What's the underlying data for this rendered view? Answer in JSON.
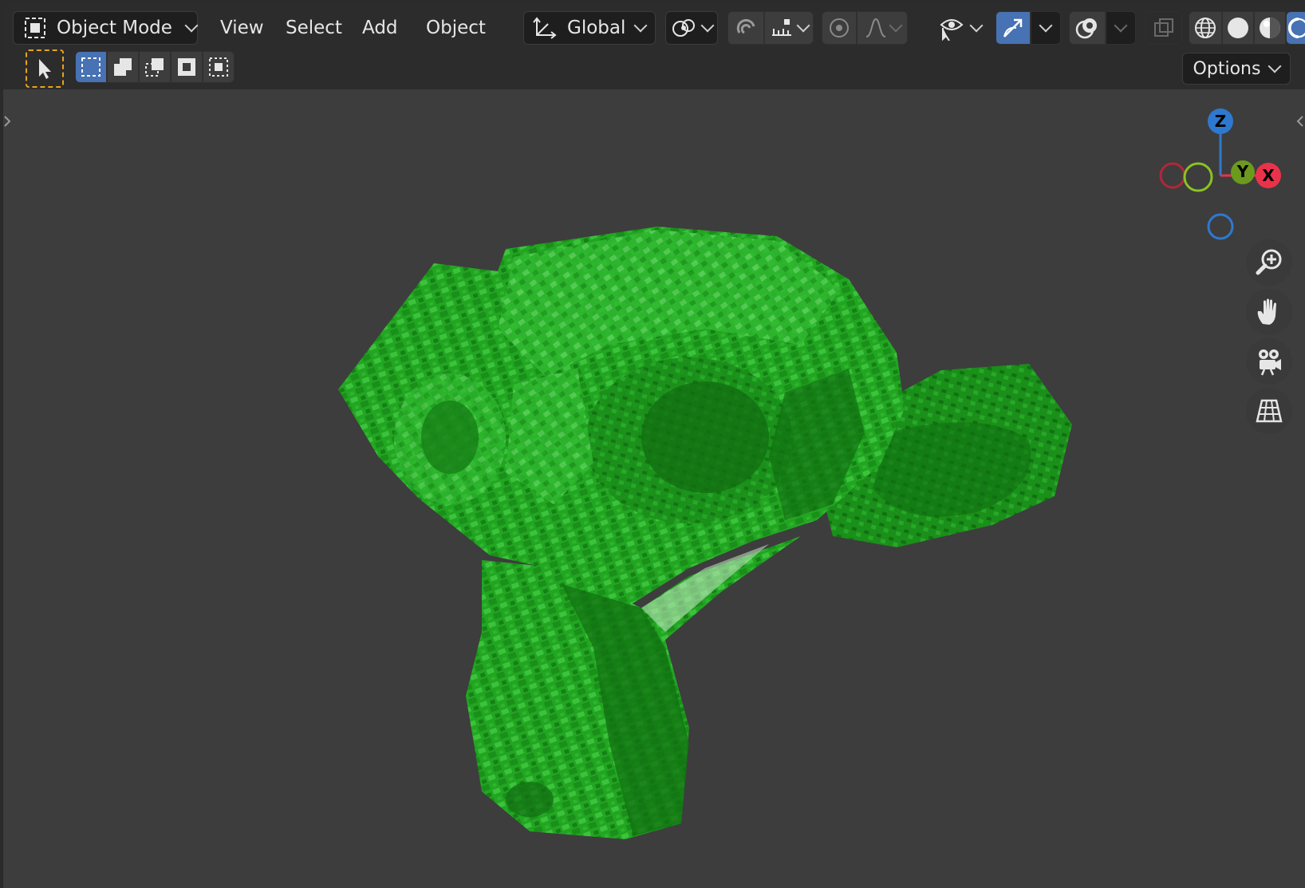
{
  "header": {
    "mode_label": "Object Mode",
    "menus": [
      "View",
      "Select",
      "Add",
      "Object"
    ],
    "transform_orientation": "Global"
  },
  "toolbar": {
    "options_label": "Options"
  },
  "gizmo": {
    "z": "Z",
    "y": "Y",
    "x": "X"
  },
  "colors": {
    "accent": "#4772b3",
    "viewport_bg": "#3d3d3d",
    "header_bg": "#2c2c2c",
    "object_green": "#22a622",
    "axis_x": "#e8334a",
    "axis_y": "#8bc322",
    "axis_z": "#2e79cf"
  },
  "icons": {
    "object_mode": "object-mode-icon",
    "transform": "transform-orientation-icon",
    "pivot": "pivot-point-icon",
    "snap": "snap-magnet-icon",
    "proportional": "proportional-editing-icon",
    "visibility": "eye-icon",
    "gizmo_toggle": "gizmo-icon",
    "overlays": "overlay-icon",
    "xray": "xray-icon",
    "wireframe": "wireframe-shading-icon",
    "solid": "solid-shading-icon",
    "material": "material-preview-icon",
    "rendered": "rendered-shading-icon",
    "zoom": "zoom-icon",
    "pan": "hand-icon",
    "camera": "camera-icon",
    "ortho": "grid-perspective-icon"
  }
}
